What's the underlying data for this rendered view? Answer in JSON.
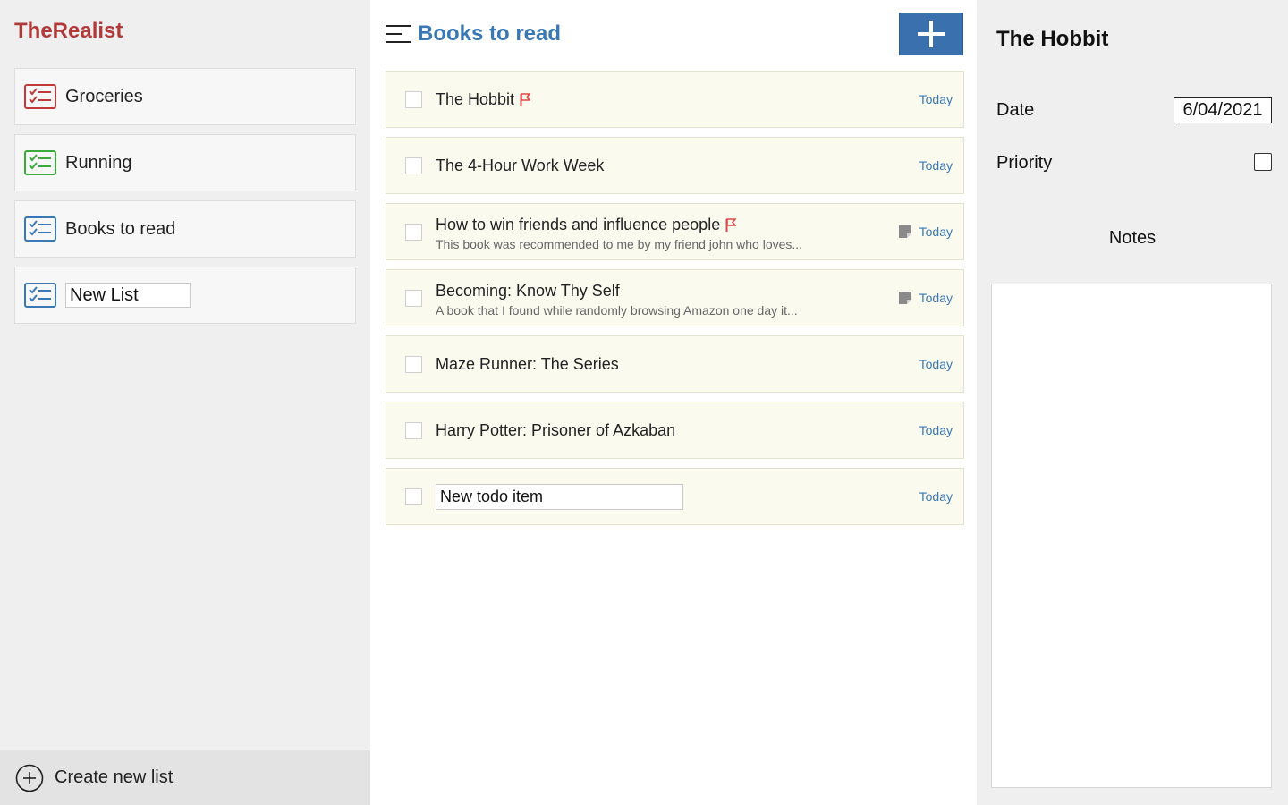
{
  "app": {
    "name": "TheRealist",
    "brand_color": "#b03a3a"
  },
  "sidebar": {
    "lists": [
      {
        "label": "Groceries",
        "icon": "checklist-icon",
        "color": "#c03a3a"
      },
      {
        "label": "Running",
        "icon": "checklist-icon",
        "color": "#3aaa3a"
      },
      {
        "label": "Books to read",
        "icon": "checklist-icon",
        "color": "#3a78b5"
      }
    ],
    "new_list_value": "New List",
    "create_label": "Create new list"
  },
  "main": {
    "title": "Books to read",
    "add_icon": "plus-icon",
    "todos": [
      {
        "title": "The Hobbit",
        "note": "",
        "date": "Today",
        "flagged": true
      },
      {
        "title": "The 4-Hour Work Week",
        "note": "",
        "date": "Today",
        "flagged": false
      },
      {
        "title": "How to win friends and influence people",
        "note": "This book was recommended to me by my friend john who loves...",
        "date": "Today",
        "flagged": true
      },
      {
        "title": "Becoming: Know Thy Self",
        "note": "A book that I found while randomly browsing Amazon one day it...",
        "date": "Today",
        "flagged": false
      },
      {
        "title": "Maze Runner: The Series",
        "note": "",
        "date": "Today",
        "flagged": false
      },
      {
        "title": "Harry Potter: Prisoner of Azkaban",
        "note": "",
        "date": "Today",
        "flagged": false
      }
    ],
    "new_todo_value": "New todo item",
    "new_todo_date": "Today"
  },
  "detail": {
    "title": "The Hobbit",
    "date_label": "Date",
    "date_value": "6/04/2021",
    "priority_label": "Priority",
    "priority_checked": false,
    "notes_label": "Notes",
    "notes_value": ""
  }
}
